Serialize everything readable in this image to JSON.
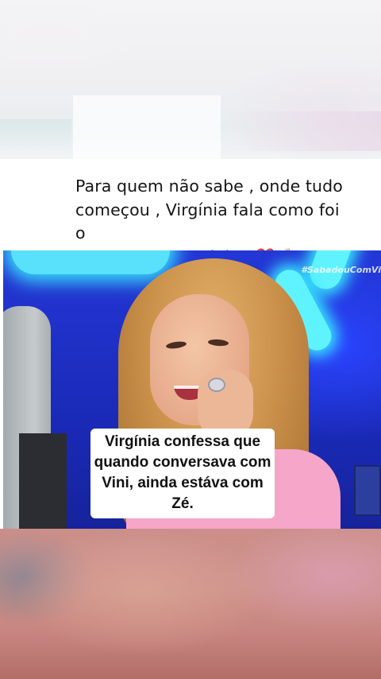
{
  "post": {
    "caption_line1": "Para quem não sabe , onde tudo",
    "caption_line2": "começou , Virgínia fala como foi o",
    "caption_line3": "começo com o vini 👀❤️🤞🏻"
  },
  "video": {
    "watermark": "#SabadouComVi",
    "subtitle": "Virgínia confessa que quando conversava com Vini, ainda estáva com Zé."
  },
  "colors": {
    "studio_blue": "#1c2fb8",
    "neon_cyan": "#5ff3ff",
    "subtitle_bg": "#ffffff"
  }
}
